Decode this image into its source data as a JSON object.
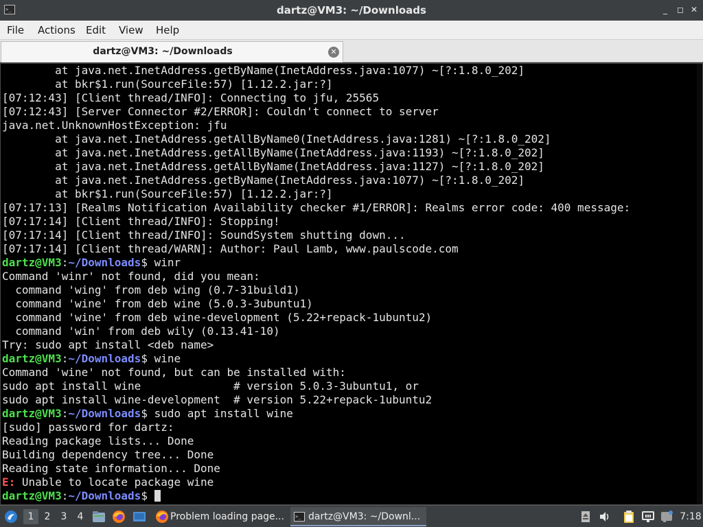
{
  "window": {
    "title": "dartz@VM3: ~/Downloads",
    "controls": {
      "minimize": "_",
      "maximize": "◻",
      "close": "✕"
    }
  },
  "menu": [
    "File",
    "Actions",
    "Edit",
    "View",
    "Help"
  ],
  "tab": {
    "label": "dartz@VM3: ~/Downloads",
    "close": "✕"
  },
  "terminal": {
    "prompt_user": "dartz@VM3",
    "prompt_path": "~/Downloads",
    "lines": [
      {
        "t": "        at java.net.InetAddress.getByName(InetAddress.java:1077) ~[?:1.8.0_202]"
      },
      {
        "t": "        at bkr$1.run(SourceFile:57) [1.12.2.jar:?]"
      },
      {
        "t": "[07:12:43] [Client thread/INFO]: Connecting to jfu, 25565"
      },
      {
        "t": "[07:12:43] [Server Connector #2/ERROR]: Couldn't connect to server"
      },
      {
        "t": "java.net.UnknownHostException: jfu"
      },
      {
        "t": "        at java.net.InetAddress.getAllByName0(InetAddress.java:1281) ~[?:1.8.0_202]"
      },
      {
        "t": "        at java.net.InetAddress.getAllByName(InetAddress.java:1193) ~[?:1.8.0_202]"
      },
      {
        "t": "        at java.net.InetAddress.getAllByName(InetAddress.java:1127) ~[?:1.8.0_202]"
      },
      {
        "t": "        at java.net.InetAddress.getByName(InetAddress.java:1077) ~[?:1.8.0_202]"
      },
      {
        "t": "        at bkr$1.run(SourceFile:57) [1.12.2.jar:?]"
      },
      {
        "t": "[07:17:13] [Realms Notification Availability checker #1/ERROR]: Realms error code: 400 message:"
      },
      {
        "t": "[07:17:14] [Client thread/INFO]: Stopping!"
      },
      {
        "t": "[07:17:14] [Client thread/INFO]: SoundSystem shutting down..."
      },
      {
        "t": "[07:17:14] [Client thread/WARN]: Author: Paul Lamb, www.paulscode.com"
      },
      {
        "prompt": true,
        "cmd": " winr"
      },
      {
        "t": "Command 'winr' not found, did you mean:"
      },
      {
        "t": "  command 'wing' from deb wing (0.7-31build1)"
      },
      {
        "t": "  command 'wine' from deb wine (5.0.3-3ubuntu1)"
      },
      {
        "t": "  command 'wine' from deb wine-development (5.22+repack-1ubuntu2)"
      },
      {
        "t": "  command 'win' from deb wily (0.13.41-10)"
      },
      {
        "t": "Try: sudo apt install <deb name>"
      },
      {
        "prompt": true,
        "cmd": " wine"
      },
      {
        "t": "Command 'wine' not found, but can be installed with:"
      },
      {
        "t": "sudo apt install wine              # version 5.0.3-3ubuntu1, or"
      },
      {
        "t": "sudo apt install wine-development  # version 5.22+repack-1ubuntu2"
      },
      {
        "prompt": true,
        "cmd": " sudo apt install wine"
      },
      {
        "t": "[sudo] password for dartz:"
      },
      {
        "t": "Reading package lists... Done"
      },
      {
        "t": "Building dependency tree... Done"
      },
      {
        "t": "Reading state information... Done"
      },
      {
        "err": "E:",
        "t": " Unable to locate package wine"
      },
      {
        "prompt": true,
        "cmd": " ",
        "cursor": true
      }
    ]
  },
  "taskbar": {
    "workspaces": [
      "1",
      "2",
      "3",
      "4"
    ],
    "tasks": [
      {
        "label": "Problem loading page..."
      },
      {
        "label": "dartz@VM3: ~/Downl..."
      }
    ],
    "clock": "7:18",
    "colors": {
      "firefox": "#ff7a1a",
      "accent": "#4a90d9"
    }
  }
}
